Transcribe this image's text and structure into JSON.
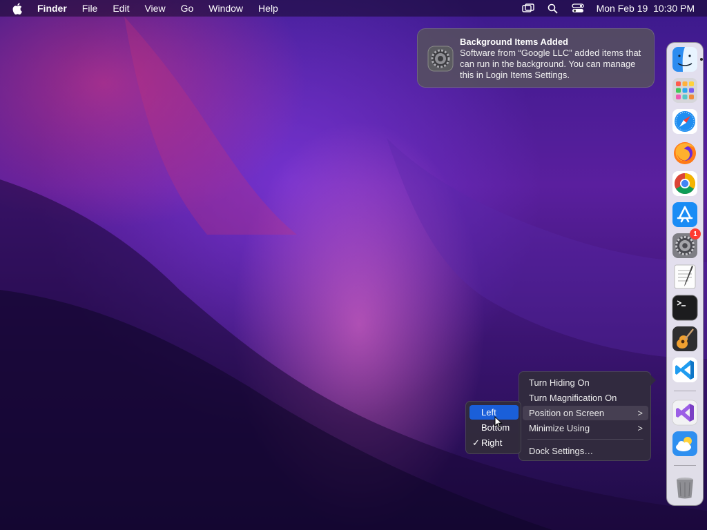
{
  "menubar": {
    "app_name": "Finder",
    "items": [
      "File",
      "Edit",
      "View",
      "Go",
      "Window",
      "Help"
    ],
    "clock": "Mon Feb 19  10:30 PM",
    "status_icons": [
      "screen-mirroring-icon",
      "spotlight-search-icon",
      "control-center-icon"
    ]
  },
  "notification": {
    "title": "Background Items Added",
    "body": "Software from “Google LLC” added items that can run in the background. You can manage this in Login Items Settings.",
    "icon": "system-settings-icon"
  },
  "dock": {
    "apps": [
      {
        "name": "Finder",
        "icon": "finder-icon",
        "running": true
      },
      {
        "name": "Launchpad",
        "icon": "launchpad-icon"
      },
      {
        "name": "Safari",
        "icon": "safari-icon"
      },
      {
        "name": "Firefox",
        "icon": "firefox-icon"
      },
      {
        "name": "Google Chrome",
        "icon": "chrome-icon"
      },
      {
        "name": "App Store",
        "icon": "app-store-icon"
      },
      {
        "name": "System Settings",
        "icon": "system-settings-icon",
        "badge": "1"
      },
      {
        "name": "TextEdit",
        "icon": "textedit-icon"
      },
      {
        "name": "Terminal",
        "icon": "terminal-icon"
      },
      {
        "name": "GarageBand",
        "icon": "garageband-icon"
      },
      {
        "name": "Visual Studio Code",
        "icon": "vscode-icon"
      },
      {
        "name": "Visual Studio",
        "icon": "visual-studio-icon"
      },
      {
        "name": "Weather",
        "icon": "weather-icon"
      },
      {
        "name": "Trash",
        "icon": "trash-icon"
      }
    ]
  },
  "context_menu": {
    "items": [
      {
        "label": "Turn Hiding On"
      },
      {
        "label": "Turn Magnification On"
      },
      {
        "label": "Position on Screen",
        "has_submenu": true,
        "hovered": true
      },
      {
        "label": "Minimize Using",
        "has_submenu": true
      },
      {
        "label": "Dock Settings…"
      }
    ],
    "submenu_chevron": ">"
  },
  "position_submenu": {
    "items": [
      {
        "label": "Left",
        "selected": true
      },
      {
        "label": "Bottom"
      },
      {
        "label": "Right",
        "checked": true
      }
    ],
    "check_mark": "✓"
  },
  "colors": {
    "selection": "#1a5fd9",
    "badge": "#ff3b30"
  }
}
